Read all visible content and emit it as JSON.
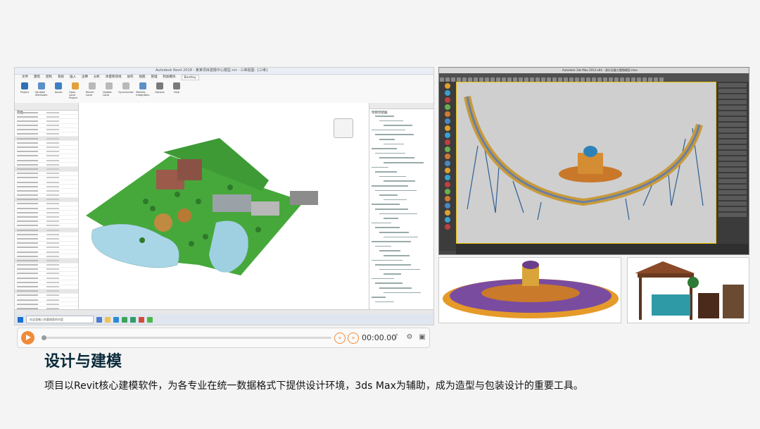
{
  "revit": {
    "window_title": "Autodesk Revit 2018 - 某某项目建模中心模型.rvt - 三维视图: {三维}",
    "menu": [
      "文件",
      "建筑",
      "结构",
      "系统",
      "插入",
      "注释",
      "分析",
      "体量和场地",
      "协作",
      "视图",
      "管理",
      "附加模块",
      "Bentley"
    ],
    "ribbon_buttons": [
      "Project",
      "Variable Attributes",
      "Issues",
      "Open Local Project",
      "Revert Local",
      "Update Local",
      "Synchronize",
      "Bentley Integration",
      "Options",
      "Help"
    ],
    "panel_properties": "属性",
    "panel_browser": "项目浏览器",
    "taskbar_search": "在这里输入你要搜索的内容"
  },
  "player": {
    "time": "00:00.00"
  },
  "max": {
    "window_title": "Autodesk 3ds Max 2014 x64 - 游乐设备大摆锤模型.max"
  },
  "heading": "设计与建模",
  "description": "项目以Revit核心建模软件，为各专业在统一数据格式下提供设计环境，3ds Max为辅助，成为造型与包装设计的重要工具。",
  "colors": {
    "accent": "#f08b3a",
    "heading": "#0a2a3a"
  }
}
